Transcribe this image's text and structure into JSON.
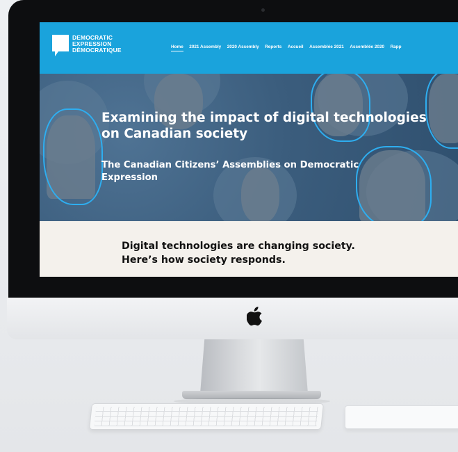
{
  "logo": {
    "lines": [
      "DEMOCRATIC",
      "EXPRESSION",
      "DÉMOCRATIQUE"
    ]
  },
  "nav": {
    "items": [
      "Home",
      "2021 Assembly",
      "2020 Assembly",
      "Reports",
      "Accueil",
      "Assemblée 2021",
      "Assemblée 2020",
      "Rapp"
    ],
    "active_index": 0
  },
  "hero": {
    "title": "Examining the impact of digital technologies on Canadian society",
    "subtitle": "The Canadian Citizens’ Assemblies on Democratic Expression"
  },
  "tagline": {
    "line1": "Digital technologies are changing society.",
    "line2": "Here’s how society responds."
  },
  "colors": {
    "header_blue": "#1aa3dc",
    "hero_overlay": "#3b5d7d",
    "accent_outline": "#2eaef0",
    "page_background": "#f4f1ec"
  },
  "icons": {
    "brand": "apple-logo-icon",
    "logo_mark": "speech-bubble-icon"
  }
}
